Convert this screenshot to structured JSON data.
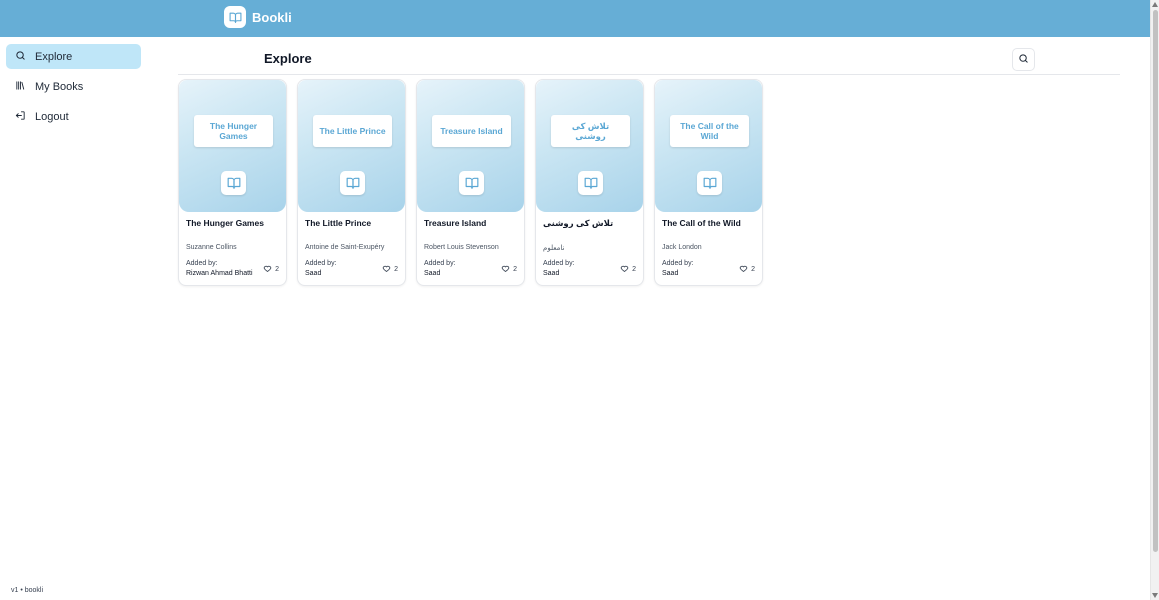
{
  "app": {
    "name": "Bookli",
    "version_text": "v1 • bookli"
  },
  "sidebar": {
    "items": [
      {
        "label": "Explore",
        "icon": "search-icon",
        "active": true
      },
      {
        "label": "My Books",
        "icon": "library-icon",
        "active": false
      },
      {
        "label": "Logout",
        "icon": "logout-icon",
        "active": false
      }
    ]
  },
  "main": {
    "title": "Explore"
  },
  "cards": [
    {
      "cover_title": "The Hunger Games",
      "title": "The Hunger Games",
      "author": "Suzanne Collins",
      "added_by_label": "Added by:",
      "added_by": "Rizwan Ahmad Bhatti",
      "likes": "2"
    },
    {
      "cover_title": "The Little Prince",
      "title": "The Little Prince",
      "author": "Antoine de Saint-Exupéry",
      "added_by_label": "Added by:",
      "added_by": "Saad",
      "likes": "2"
    },
    {
      "cover_title": "Treasure Island",
      "title": "Treasure Island",
      "author": "Robert Louis Stevenson",
      "added_by_label": "Added by:",
      "added_by": "Saad",
      "likes": "2"
    },
    {
      "cover_title": "تلاش کی روشنی",
      "title": "تلاش کی روشنی",
      "author": "نامعلوم",
      "added_by_label": "Added by:",
      "added_by": "Saad",
      "likes": "2"
    },
    {
      "cover_title": "The Call of the Wild",
      "title": "The Call of the Wild",
      "author": "Jack London",
      "added_by_label": "Added by:",
      "added_by": "Saad",
      "likes": "2"
    }
  ],
  "colors": {
    "header": "#66aed6",
    "active_nav": "#bfe6f8",
    "accent_text": "#5aa7d4"
  }
}
